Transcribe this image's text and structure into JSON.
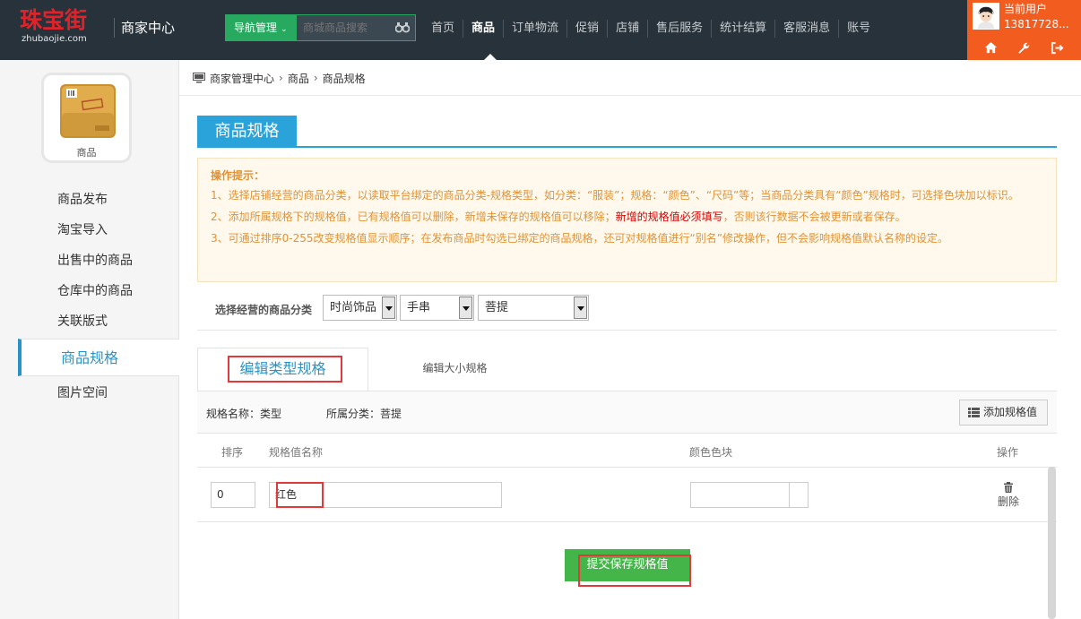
{
  "header": {
    "logo_cn": "珠宝街",
    "logo_en": "zhubaojie.com",
    "site_name": "商家中心",
    "nav_button": "导航管理",
    "search_placeholder": "商城商品搜索",
    "menu": [
      "首页",
      "商品",
      "订单物流",
      "促销",
      "店铺",
      "售后服务",
      "统计结算",
      "客服消息",
      "账号"
    ],
    "active_menu": "商品",
    "user_label": "当前用户",
    "user_phone": "13817728...",
    "accent_color": "#f25c1f",
    "nav_color": "#27a960"
  },
  "sidebar": {
    "module_label": "商品",
    "items": [
      "商品发布",
      "淘宝导入",
      "出售中的商品",
      "仓库中的商品",
      "关联版式",
      "商品规格",
      "图片空间"
    ],
    "active_item": "商品规格"
  },
  "breadcrumb": [
    "商家管理中心",
    "商品",
    "商品规格"
  ],
  "page_title": "商品规格",
  "tips": {
    "title": "操作提示：",
    "line1": "1、选择店铺经营的商品分类，以读取平台绑定的商品分类-规格类型，如分类：“服装”；规格：“颜色”、“尺码”等；当商品分类具有“颜色”规格时，可选择色块加以标识。",
    "line2_a": "2、添加所属规格下的规格值，已有规格值可以删除，新增未保存的规格值可以移除；",
    "line2_red": "新增的规格值必须填写",
    "line2_b": "，否则该行数据不会被更新或者保存。",
    "line3": "3、可通过排序0-255改变规格值显示顺序；在发布商品时勾选已绑定的商品规格，还可对规格值进行“别名”修改操作，但不会影响规格值默认名称的设定。"
  },
  "category": {
    "label": "选择经营的商品分类",
    "select1": "时尚饰品",
    "select2": "手串",
    "select3": "菩提"
  },
  "tabs": {
    "active": "编辑类型规格",
    "other": "编辑大小规格"
  },
  "spec": {
    "name": "规格名称：类型",
    "category": "所属分类：菩提",
    "add_button": "添加规格值"
  },
  "table": {
    "headers": [
      "排序",
      "规格值名称",
      "颜色色块",
      "操作"
    ],
    "rows": [
      {
        "order": "0",
        "name": "红色",
        "color": "",
        "action": "删除"
      }
    ]
  },
  "submit_button": "提交保存规格值",
  "highlight_color": "#e23a3a"
}
